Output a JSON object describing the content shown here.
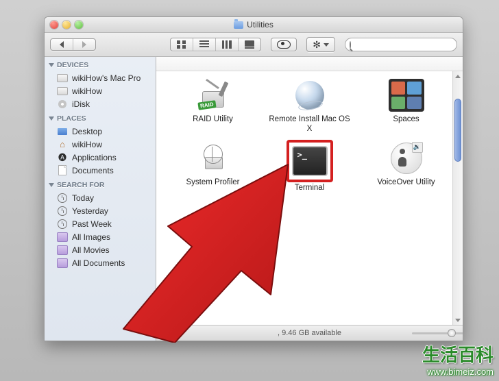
{
  "window": {
    "title": "Utilities"
  },
  "toolbar": {
    "search_placeholder": ""
  },
  "sidebar": {
    "sections": [
      {
        "label": "DEVICES",
        "items": [
          {
            "label": "wikiHow's Mac Pro",
            "icon": "drive"
          },
          {
            "label": "wikiHow",
            "icon": "drive"
          },
          {
            "label": "iDisk",
            "icon": "disc"
          }
        ]
      },
      {
        "label": "PLACES",
        "items": [
          {
            "label": "Desktop",
            "icon": "desktop"
          },
          {
            "label": "wikiHow",
            "icon": "home"
          },
          {
            "label": "Applications",
            "icon": "app"
          },
          {
            "label": "Documents",
            "icon": "doc"
          }
        ]
      },
      {
        "label": "SEARCH FOR",
        "items": [
          {
            "label": "Today",
            "icon": "clock"
          },
          {
            "label": "Yesterday",
            "icon": "clock"
          },
          {
            "label": "Past Week",
            "icon": "clock"
          },
          {
            "label": "All Images",
            "icon": "smart"
          },
          {
            "label": "All Movies",
            "icon": "smart"
          },
          {
            "label": "All Documents",
            "icon": "smart"
          }
        ]
      }
    ]
  },
  "content": {
    "items": [
      {
        "label": "RAID Utility",
        "icon": "raid",
        "highlighted": false,
        "raid_badge": "RAID"
      },
      {
        "label": "Remote Install Mac OS X",
        "icon": "globe",
        "highlighted": false
      },
      {
        "label": "Spaces",
        "icon": "spaces",
        "highlighted": false
      },
      {
        "label": "System Profiler",
        "icon": "profiler",
        "highlighted": false
      },
      {
        "label": "Terminal",
        "icon": "terminal",
        "highlighted": true
      },
      {
        "label": "VoiceOver Utility",
        "icon": "voiceover",
        "highlighted": false
      }
    ]
  },
  "status": {
    "text": ", 9.46 GB available"
  },
  "watermark": {
    "cn": "生活百科",
    "url": "www.bimeiz.com"
  }
}
